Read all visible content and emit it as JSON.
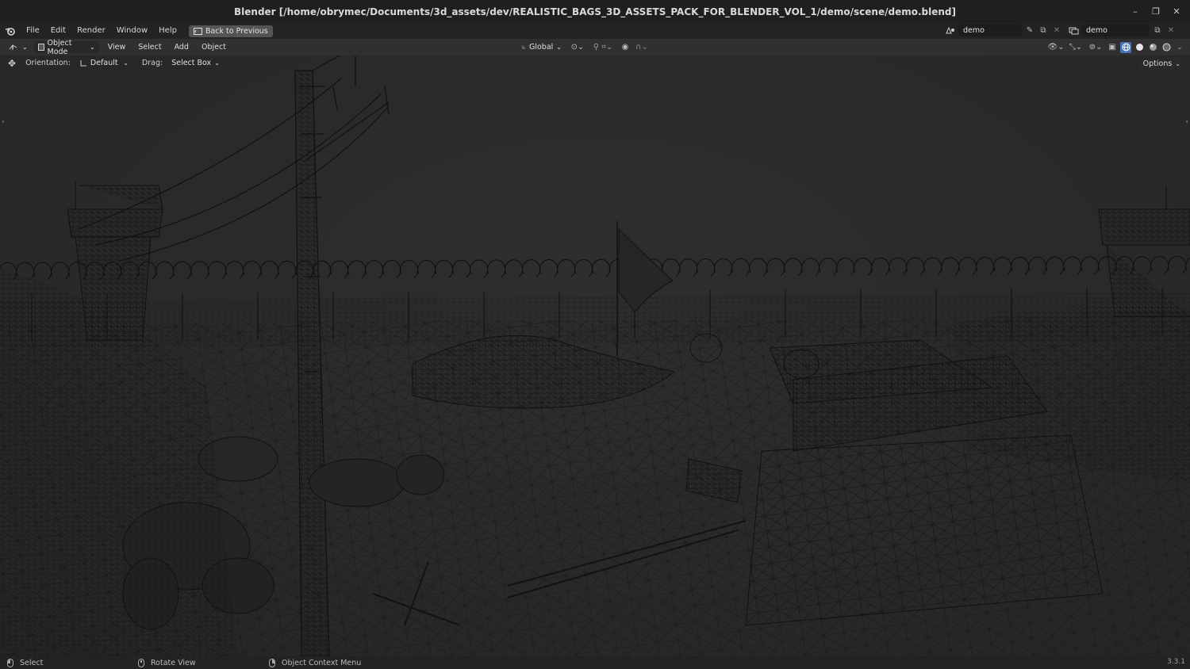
{
  "window": {
    "title": "Blender [/home/obrymec/Documents/3d_assets/dev/REALISTIC_BAGS_3D_ASSETS_PACK_FOR_BLENDER_VOL_1/demo/scene/demo.blend]",
    "controls": {
      "minimize": "–",
      "restore": "❐",
      "close": "✕"
    }
  },
  "menu": {
    "items": [
      "File",
      "Edit",
      "Render",
      "Window",
      "Help"
    ],
    "back_to_previous": "Back to Previous"
  },
  "scene_selector": {
    "scene": "demo",
    "view_layer": "demo"
  },
  "viewport_header": {
    "mode": "Object Mode",
    "menus": [
      "View",
      "Select",
      "Add",
      "Object"
    ],
    "transform_orientation": "Global",
    "shading_active": "wireframe"
  },
  "tool_settings": {
    "orientation_label": "Orientation:",
    "orientation_value": "Default",
    "drag_label": "Drag:",
    "drag_value": "Select Box",
    "options_label": "Options"
  },
  "status_bar": {
    "select": "Select",
    "rotate_view": "Rotate View",
    "context_menu": "Object Context Menu",
    "version": "3.3.1"
  },
  "colors": {
    "viewport_bg": "#2b2b2b",
    "wire": "#0d0d0d",
    "accent": "#4772b3"
  }
}
